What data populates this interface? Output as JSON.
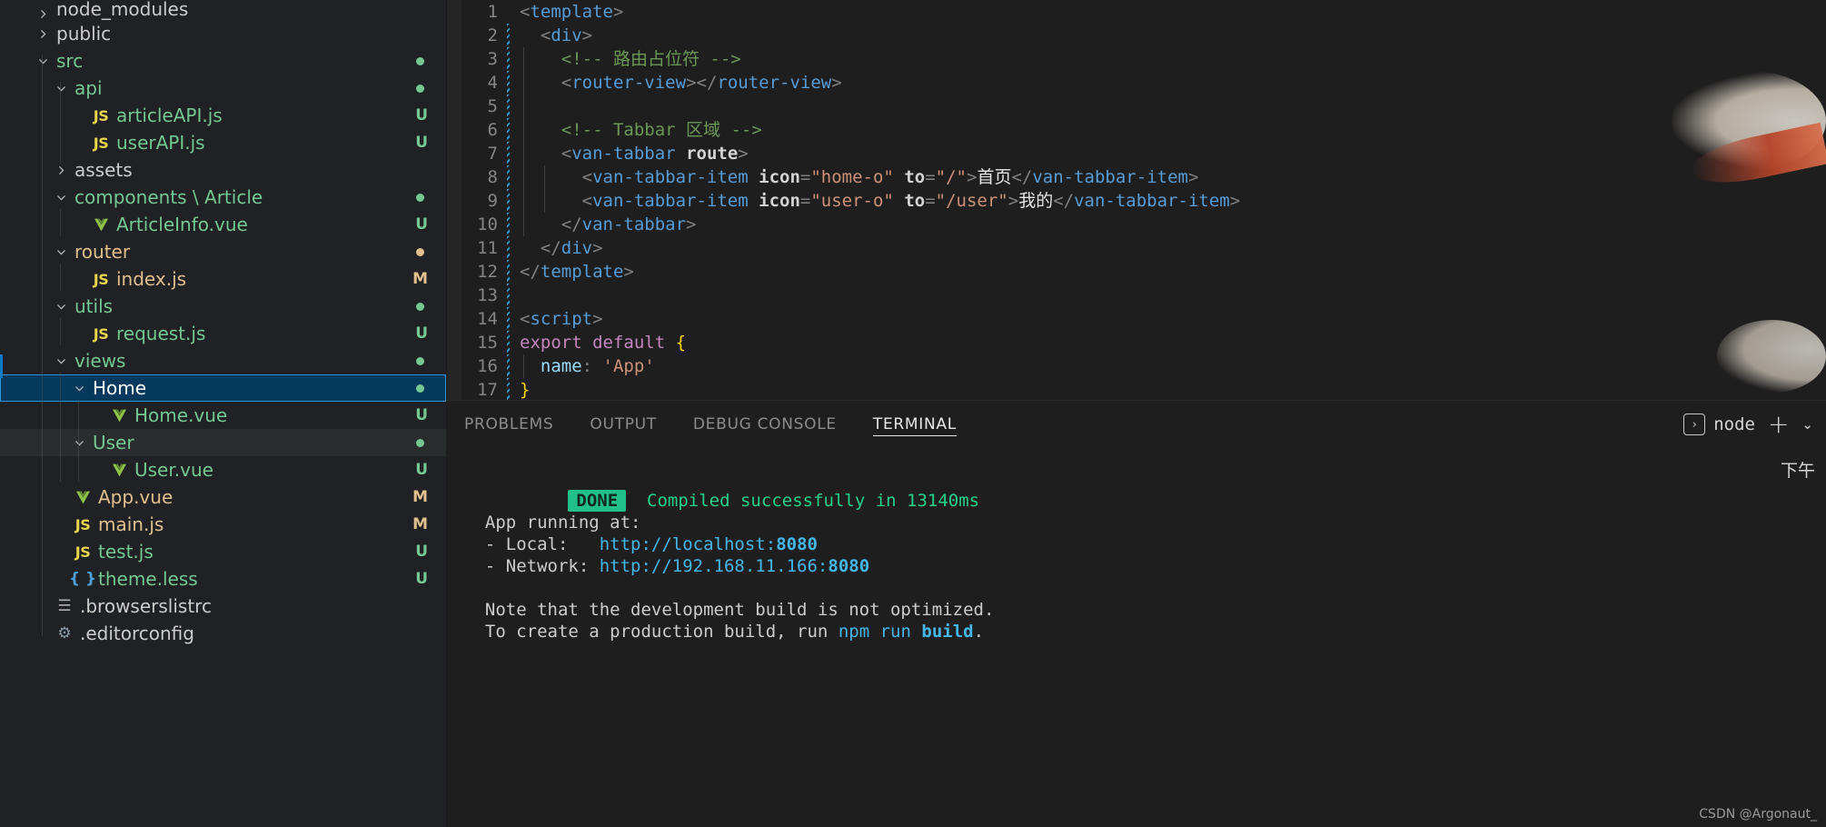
{
  "sidebar": {
    "items": [
      {
        "label": "node_modules",
        "kind": "folder",
        "depth": 0,
        "expanded": false,
        "color": "white",
        "status": "",
        "dot": "",
        "cut": true
      },
      {
        "label": "public",
        "kind": "folder",
        "depth": 0,
        "expanded": false,
        "color": "white",
        "status": "",
        "dot": ""
      },
      {
        "label": "src",
        "kind": "folder",
        "depth": 0,
        "expanded": true,
        "color": "green",
        "status": "",
        "dot": "g"
      },
      {
        "label": "api",
        "kind": "folder",
        "depth": 1,
        "expanded": true,
        "color": "green",
        "status": "",
        "dot": "g"
      },
      {
        "label": "articleAPI.js",
        "kind": "js",
        "depth": 2,
        "color": "green",
        "status": "U",
        "dot": ""
      },
      {
        "label": "userAPI.js",
        "kind": "js",
        "depth": 2,
        "color": "green",
        "status": "U",
        "dot": ""
      },
      {
        "label": "assets",
        "kind": "folder",
        "depth": 1,
        "expanded": false,
        "color": "white",
        "status": "",
        "dot": ""
      },
      {
        "label": "components \\ Article",
        "kind": "folder",
        "depth": 1,
        "expanded": true,
        "color": "green",
        "status": "",
        "dot": "g"
      },
      {
        "label": "ArticleInfo.vue",
        "kind": "vue",
        "depth": 2,
        "color": "green",
        "status": "U",
        "dot": ""
      },
      {
        "label": "router",
        "kind": "folder",
        "depth": 1,
        "expanded": true,
        "color": "amber",
        "status": "",
        "dot": "a"
      },
      {
        "label": "index.js",
        "kind": "js",
        "depth": 2,
        "color": "amber",
        "status": "M",
        "dot": ""
      },
      {
        "label": "utils",
        "kind": "folder",
        "depth": 1,
        "expanded": true,
        "color": "green",
        "status": "",
        "dot": "g"
      },
      {
        "label": "request.js",
        "kind": "js",
        "depth": 2,
        "color": "green",
        "status": "U",
        "dot": ""
      },
      {
        "label": "views",
        "kind": "folder",
        "depth": 1,
        "expanded": true,
        "color": "green",
        "status": "",
        "dot": "g"
      },
      {
        "label": "Home",
        "kind": "folder",
        "depth": 2,
        "expanded": true,
        "color": "green",
        "status": "",
        "dot": "g",
        "selected": true
      },
      {
        "label": "Home.vue",
        "kind": "vue",
        "depth": 3,
        "color": "green",
        "status": "U",
        "dot": ""
      },
      {
        "label": "User",
        "kind": "folder",
        "depth": 2,
        "expanded": true,
        "color": "green",
        "status": "",
        "dot": "g",
        "hover": true
      },
      {
        "label": "User.vue",
        "kind": "vue",
        "depth": 3,
        "color": "green",
        "status": "U",
        "dot": ""
      },
      {
        "label": "App.vue",
        "kind": "vue",
        "depth": 1,
        "color": "amber",
        "status": "M",
        "dot": ""
      },
      {
        "label": "main.js",
        "kind": "js",
        "depth": 1,
        "color": "amber",
        "status": "M",
        "dot": ""
      },
      {
        "label": "test.js",
        "kind": "js",
        "depth": 1,
        "color": "green",
        "status": "U",
        "dot": ""
      },
      {
        "label": "theme.less",
        "kind": "less",
        "depth": 1,
        "color": "green",
        "status": "U",
        "dot": ""
      },
      {
        "label": ".browserslistrc",
        "kind": "list",
        "depth": 0,
        "color": "white",
        "status": "",
        "dot": ""
      },
      {
        "label": ".editorconfig",
        "kind": "gear",
        "depth": 0,
        "color": "white",
        "status": "",
        "dot": ""
      }
    ]
  },
  "editor": {
    "lines": [
      {
        "n": "1",
        "tokens": [
          {
            "t": "<",
            "c": "brk"
          },
          {
            "t": "template",
            "c": "tag"
          },
          {
            "t": ">",
            "c": "brk"
          }
        ],
        "indent": 0
      },
      {
        "n": "2",
        "tokens": [
          {
            "t": "  ",
            "c": "txt"
          },
          {
            "t": "<",
            "c": "brk"
          },
          {
            "t": "div",
            "c": "tag"
          },
          {
            "t": ">",
            "c": "brk"
          }
        ],
        "indent": 0
      },
      {
        "n": "3",
        "tokens": [
          {
            "t": "    ",
            "c": "txt"
          },
          {
            "t": "<!-- 路由占位符 -->",
            "c": "cmt"
          }
        ],
        "indent": 1
      },
      {
        "n": "4",
        "tokens": [
          {
            "t": "    ",
            "c": "txt"
          },
          {
            "t": "<",
            "c": "brk"
          },
          {
            "t": "router-view",
            "c": "tag"
          },
          {
            "t": "></",
            "c": "brk"
          },
          {
            "t": "router-view",
            "c": "tag"
          },
          {
            "t": ">",
            "c": "brk"
          }
        ],
        "indent": 1
      },
      {
        "n": "5",
        "tokens": [],
        "indent": 1
      },
      {
        "n": "6",
        "tokens": [
          {
            "t": "    ",
            "c": "txt"
          },
          {
            "t": "<!-- Tabbar 区域 -->",
            "c": "cmt"
          }
        ],
        "indent": 1
      },
      {
        "n": "7",
        "tokens": [
          {
            "t": "    ",
            "c": "txt"
          },
          {
            "t": "<",
            "c": "brk"
          },
          {
            "t": "van-tabbar",
            "c": "tag"
          },
          {
            "t": " ",
            "c": "txt"
          },
          {
            "t": "route",
            "c": "attrb"
          },
          {
            "t": ">",
            "c": "brk"
          }
        ],
        "indent": 1
      },
      {
        "n": "8",
        "tokens": [
          {
            "t": "      ",
            "c": "txt"
          },
          {
            "t": "<",
            "c": "brk"
          },
          {
            "t": "van-tabbar-item",
            "c": "tag"
          },
          {
            "t": " ",
            "c": "txt"
          },
          {
            "t": "icon",
            "c": "attrb"
          },
          {
            "t": "=",
            "c": "brk"
          },
          {
            "t": "\"home-o\"",
            "c": "str"
          },
          {
            "t": " ",
            "c": "txt"
          },
          {
            "t": "to",
            "c": "attrb"
          },
          {
            "t": "=",
            "c": "brk"
          },
          {
            "t": "\"/\"",
            "c": "str"
          },
          {
            "t": ">",
            "c": "brk"
          },
          {
            "t": "首页",
            "c": "txt"
          },
          {
            "t": "</",
            "c": "brk"
          },
          {
            "t": "van-tabbar-item",
            "c": "tag"
          },
          {
            "t": ">",
            "c": "brk"
          }
        ],
        "indent": 2
      },
      {
        "n": "9",
        "tokens": [
          {
            "t": "      ",
            "c": "txt"
          },
          {
            "t": "<",
            "c": "brk"
          },
          {
            "t": "van-tabbar-item",
            "c": "tag"
          },
          {
            "t": " ",
            "c": "txt"
          },
          {
            "t": "icon",
            "c": "attrb"
          },
          {
            "t": "=",
            "c": "brk"
          },
          {
            "t": "\"user-o\"",
            "c": "str"
          },
          {
            "t": " ",
            "c": "txt"
          },
          {
            "t": "to",
            "c": "attrb"
          },
          {
            "t": "=",
            "c": "brk"
          },
          {
            "t": "\"/user\"",
            "c": "str"
          },
          {
            "t": ">",
            "c": "brk"
          },
          {
            "t": "我的",
            "c": "txt"
          },
          {
            "t": "</",
            "c": "brk"
          },
          {
            "t": "van-tabbar-item",
            "c": "tag"
          },
          {
            "t": ">",
            "c": "brk"
          }
        ],
        "indent": 2
      },
      {
        "n": "10",
        "tokens": [
          {
            "t": "    ",
            "c": "txt"
          },
          {
            "t": "</",
            "c": "brk"
          },
          {
            "t": "van-tabbar",
            "c": "tag"
          },
          {
            "t": ">",
            "c": "brk"
          }
        ],
        "indent": 1
      },
      {
        "n": "11",
        "tokens": [
          {
            "t": "  ",
            "c": "txt"
          },
          {
            "t": "</",
            "c": "brk"
          },
          {
            "t": "div",
            "c": "tag"
          },
          {
            "t": ">",
            "c": "brk"
          }
        ],
        "indent": 0
      },
      {
        "n": "12",
        "tokens": [
          {
            "t": "</",
            "c": "brk"
          },
          {
            "t": "template",
            "c": "tag"
          },
          {
            "t": ">",
            "c": "brk"
          }
        ],
        "indent": 0
      },
      {
        "n": "13",
        "tokens": [],
        "indent": 0
      },
      {
        "n": "14",
        "tokens": [
          {
            "t": "<",
            "c": "brk"
          },
          {
            "t": "script",
            "c": "tag"
          },
          {
            "t": ">",
            "c": "brk"
          }
        ],
        "indent": 0
      },
      {
        "n": "15",
        "tokens": [
          {
            "t": "export default ",
            "c": "kw"
          },
          {
            "t": "{",
            "c": "yel"
          }
        ],
        "indent": 0
      },
      {
        "n": "16",
        "tokens": [
          {
            "t": "  ",
            "c": "txt"
          },
          {
            "t": "name",
            "c": "prop"
          },
          {
            "t": ": ",
            "c": "brk"
          },
          {
            "t": "'App'",
            "c": "str"
          }
        ],
        "indent": 1
      },
      {
        "n": "17",
        "tokens": [
          {
            "t": "}",
            "c": "yel"
          }
        ],
        "indent": 0
      }
    ]
  },
  "panel": {
    "tabs": [
      {
        "label": "PROBLEMS",
        "active": false
      },
      {
        "label": "OUTPUT",
        "active": false
      },
      {
        "label": "DEBUG CONSOLE",
        "active": false
      },
      {
        "label": "TERMINAL",
        "active": true
      }
    ],
    "shell_label": "node",
    "add_label": "+",
    "chevron_label": "⌄",
    "terminal_icon_glyph": "›"
  },
  "terminal": {
    "done_badge": "DONE",
    "done_message": "Compiled successfully in 13140ms",
    "lines": [
      {
        "segs": [
          {
            "t": "  App running at:",
            "c": "wht"
          }
        ]
      },
      {
        "segs": [
          {
            "t": "  - Local:   ",
            "c": "wht"
          },
          {
            "t": "http://localhost:",
            "c": "blue"
          },
          {
            "t": "8080",
            "c": "blueb"
          }
        ]
      },
      {
        "segs": [
          {
            "t": "  - Network: ",
            "c": "wht"
          },
          {
            "t": "http://192.168.11.166:",
            "c": "blue"
          },
          {
            "t": "8080",
            "c": "blueb"
          }
        ]
      },
      {
        "segs": []
      },
      {
        "segs": [
          {
            "t": "  Note that the development build is not optimized.",
            "c": "wht"
          }
        ]
      },
      {
        "segs": [
          {
            "t": "  To create a production build, run ",
            "c": "wht"
          },
          {
            "t": "npm",
            "c": "blue"
          },
          {
            "t": " ",
            "c": "wht"
          },
          {
            "t": "run",
            "c": "blue"
          },
          {
            "t": " ",
            "c": "wht"
          },
          {
            "t": "build",
            "c": "blueb"
          },
          {
            "t": ".",
            "c": "wht"
          }
        ]
      }
    ]
  },
  "overlay": {
    "clock_text": "下午",
    "watermark": "CSDN @Argonaut_"
  }
}
